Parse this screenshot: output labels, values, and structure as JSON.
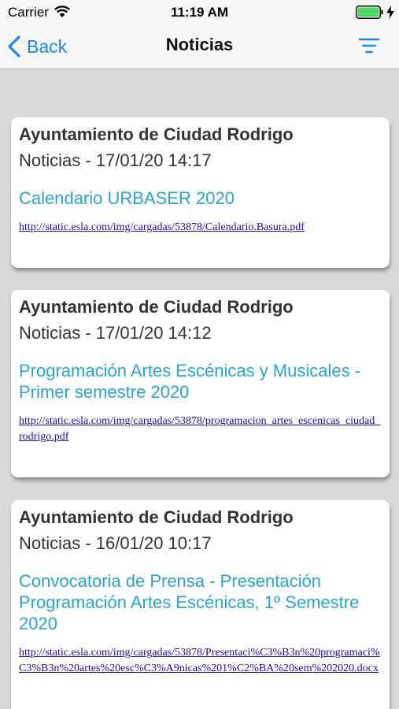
{
  "status_bar": {
    "carrier": "Carrier",
    "time": "11:19 AM",
    "battery_color": "#4cd964"
  },
  "nav": {
    "back_label": "Back",
    "title": "Noticias",
    "filter_icon": "filter-icon",
    "accent": "#1b87f5"
  },
  "news": [
    {
      "source": "Ayuntamiento de Ciudad Rodrigo",
      "meta": "Noticias - 17/01/20 14:17",
      "title": "Calendario URBASER 2020",
      "link": "http://static.esla.com/img/cargadas/53878/Calendario.Basura.pdf"
    },
    {
      "source": "Ayuntamiento de Ciudad Rodrigo",
      "meta": "Noticias - 17/01/20 14:12",
      "title": "Programación Artes Escénicas y Musicales - Primer semestre 2020",
      "link": "http://static.esla.com/img/cargadas/53878/programacion_artes_escenicas_ciudad_rodrigo.pdf"
    },
    {
      "source": "Ayuntamiento de Ciudad Rodrigo",
      "meta": "Noticias - 16/01/20 10:17",
      "title": "Convocatoria de Prensa - Presentación Programación Artes Escénicas, 1º Semestre 2020",
      "link": "http://static.esla.com/img/cargadas/53878/Presentaci%C3%B3n%20programaci%C3%B3n%20artes%20esc%C3%A9nicas%201%C2%BA%20sem%202020.docx"
    }
  ]
}
